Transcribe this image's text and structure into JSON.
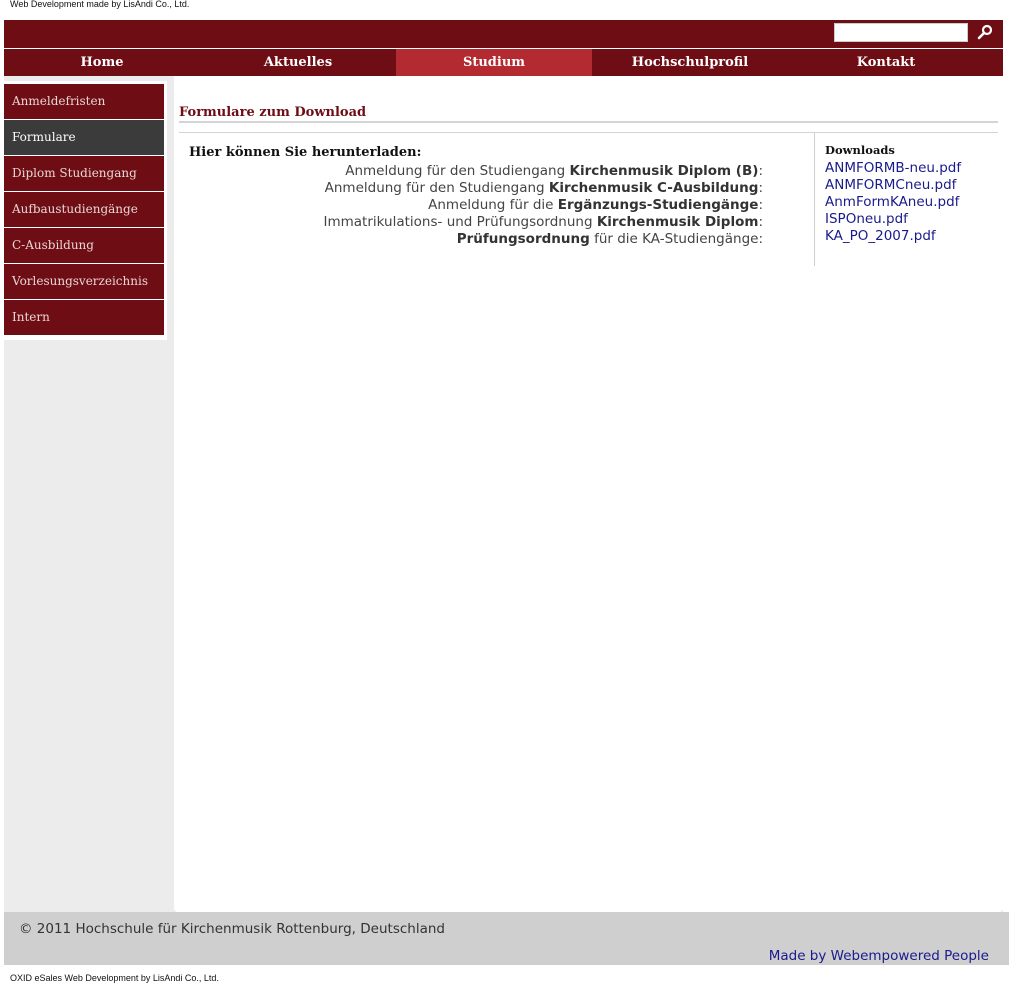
{
  "top_credit": "Web Development made by LisAndi Co., Ltd.",
  "search": {
    "placeholder": "",
    "icon": "search-icon"
  },
  "nav": {
    "items": [
      "Home",
      "Aktuelles",
      "Studium",
      "Hochschulprofil",
      "Kontakt"
    ],
    "active": "Studium"
  },
  "sidebar": {
    "items": [
      "Anmeldefristen",
      "Formulare",
      "Diplom Studiengang",
      "Aufbaustudiengänge",
      "C-Ausbildung",
      "Vorlesungsverzeichnis",
      "Intern"
    ],
    "active": "Formulare"
  },
  "content": {
    "title": "Formulare zum Download",
    "intro": "Hier können Sie herunterladen:",
    "rows": [
      {
        "prefix": "Anmeldung für den Studiengang ",
        "bold": "Kirchenmusik Diplom (B)",
        "suffix": ":"
      },
      {
        "prefix": "Anmeldung für den Studiengang ",
        "bold": "Kirchenmusik C-Ausbildung",
        "suffix": ":"
      },
      {
        "prefix": "Anmeldung für die ",
        "bold": "Ergänzungs-Studiengänge",
        "suffix": ":"
      },
      {
        "prefix": "Immatrikulations- und Prüfungsordnung ",
        "bold": "Kirchenmusik Diplom",
        "suffix": ":"
      },
      {
        "prefix": "",
        "bold": "Prüfungsordnung",
        "suffix": " für die KA-Studiengänge:"
      }
    ]
  },
  "downloads": {
    "title": "Downloads",
    "files": [
      "ANMFORMB-neu.pdf",
      "ANMFORMCneu.pdf",
      "AnmFormKAneu.pdf",
      "ISPOneu.pdf",
      "KA_PO_2007.pdf"
    ]
  },
  "footer": {
    "copyright": "© 2011 Hochschule für Kirchenmusik Rottenburg, Deutschland",
    "made_by": "Made by Webempowered People"
  },
  "bottom_credit": "OXID eSales Web Development by LisAndi Co., Ltd.",
  "colors": {
    "brand": "#6e0d14",
    "nav_active": "#b32a31",
    "sidebar_active": "#3b3b3b",
    "link": "#1a1a8c"
  }
}
